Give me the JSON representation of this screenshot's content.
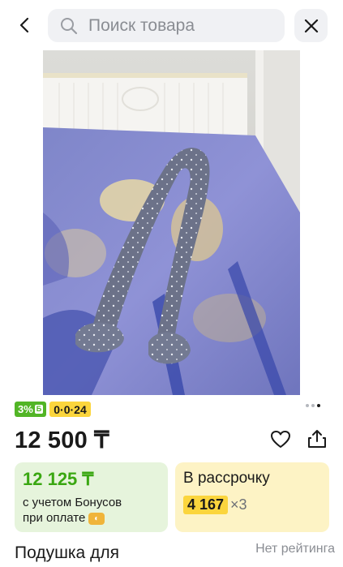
{
  "header": {
    "search_placeholder": "Поиск товара"
  },
  "badges": {
    "bonus_percent": "3%",
    "bonus_mark": "Б",
    "installment": "0·0·24"
  },
  "gallery": {
    "image_alt": "Подушка для беременных на кровати",
    "dots_total": 3,
    "dots_active_index": 2
  },
  "price": {
    "main": "12 500 ₸"
  },
  "bonus_card": {
    "price": "12 125 ₸",
    "line1": "с учетом Бонусов",
    "line2": "при оплате"
  },
  "installment_card": {
    "title": "В рассрочку",
    "amount": "4 167",
    "multiplier": "×3"
  },
  "product": {
    "title": "Подушка для",
    "rating": "Нет рейтинга"
  },
  "colors": {
    "bonus_green": "#52b526",
    "installment_yellow": "#fbd53d",
    "bonus_card_bg": "#e6f4dc",
    "installment_card_bg": "#fdf3c5"
  }
}
